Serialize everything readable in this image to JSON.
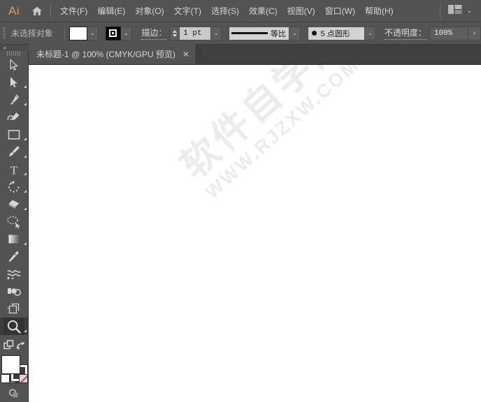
{
  "app": {
    "logo_text": "Ai",
    "home_icon": "home-icon"
  },
  "menubar": {
    "items": [
      {
        "label": "文件(F)",
        "name": "menu-file"
      },
      {
        "label": "编辑(E)",
        "name": "menu-edit"
      },
      {
        "label": "对象(O)",
        "name": "menu-object"
      },
      {
        "label": "文字(T)",
        "name": "menu-type"
      },
      {
        "label": "选择(S)",
        "name": "menu-select"
      },
      {
        "label": "效果(C)",
        "name": "menu-effect"
      },
      {
        "label": "视图(V)",
        "name": "menu-view"
      },
      {
        "label": "窗口(W)",
        "name": "menu-window"
      },
      {
        "label": "帮助(H)",
        "name": "menu-help"
      }
    ],
    "workspace_icon": "workspace-switcher-icon",
    "workspace_caret": "⌄"
  },
  "controlbar": {
    "grip_icon": "drag-grip-icon",
    "status_text": "未选择对象",
    "fill_swatch": {
      "name": "fill-color-swatch",
      "color": "#ffffff"
    },
    "fill_caret": "⌄",
    "stroke_swatch": {
      "name": "stroke-color-swatch",
      "color": "#000000"
    },
    "stroke_caret": "⌄",
    "stroke_label": "描边：",
    "stroke_weight": "1 pt",
    "stroke_weight_caret": "⌄",
    "stroke_profile": "等比",
    "stroke_profile_caret": "⌄",
    "brush_definition": "5 点圆形",
    "brush_caret": "⌄",
    "opacity_label": "不透明度：",
    "opacity_value": "100%",
    "opacity_arrow": "›"
  },
  "tabbar": {
    "tabs": [
      {
        "title": "未标题-1 @ 100% (CMYK/GPU 预览)",
        "close": "✕",
        "active": true
      }
    ]
  },
  "toolbar": {
    "collapse_icon": "»",
    "grip_icon": "toolbar-grip-icon",
    "tools": [
      {
        "name": "tool-selection",
        "label": "选择工具",
        "flyout": false,
        "active": false
      },
      {
        "name": "tool-direct-selection",
        "label": "直接选择工具",
        "flyout": true,
        "active": false
      },
      {
        "name": "tool-pen",
        "label": "钢笔工具",
        "flyout": true,
        "active": false
      },
      {
        "name": "tool-curvature",
        "label": "曲率工具",
        "flyout": false,
        "active": false
      },
      {
        "name": "tool-rectangle",
        "label": "矩形工具",
        "flyout": true,
        "active": false
      },
      {
        "name": "tool-paintbrush",
        "label": "画笔工具",
        "flyout": true,
        "active": false
      },
      {
        "name": "tool-type",
        "label": "文字工具",
        "flyout": true,
        "active": false
      },
      {
        "name": "tool-rotate",
        "label": "旋转工具",
        "flyout": true,
        "active": false
      },
      {
        "name": "tool-eraser",
        "label": "橡皮擦工具",
        "flyout": true,
        "active": false
      },
      {
        "name": "tool-lasso",
        "label": "套索工具",
        "flyout": false,
        "active": false
      },
      {
        "name": "tool-gradient",
        "label": "渐变工具",
        "flyout": true,
        "active": false
      },
      {
        "name": "tool-eyedropper",
        "label": "吸管工具",
        "flyout": false,
        "active": false
      },
      {
        "name": "tool-blend",
        "label": "混合工具",
        "flyout": false,
        "active": false
      },
      {
        "name": "tool-shape-builder",
        "label": "形状生成器工具",
        "flyout": false,
        "active": false
      },
      {
        "name": "tool-artboard",
        "label": "画板工具",
        "flyout": false,
        "active": false
      },
      {
        "name": "tool-zoom",
        "label": "缩放工具",
        "flyout": true,
        "active": true
      }
    ],
    "bottom": {
      "change_screen_mode_icon": "change-screen-mode-icon",
      "swap_fill_stroke_icon": "swap-fill-stroke-icon",
      "fill_color": "#ffffff",
      "stroke_color": "#3b3b3b",
      "color_mode_icon": "color-fill-icon",
      "gradient_mode_icon": "gradient-fill-icon",
      "none_mode_icon": "none-fill-icon",
      "drawing_mode_icon": "drawing-mode-icon"
    }
  },
  "canvas": {
    "background": "#ffffff",
    "watermark_cn": "软件自学网",
    "watermark_en": "WWW.RJZXW.COM"
  }
}
